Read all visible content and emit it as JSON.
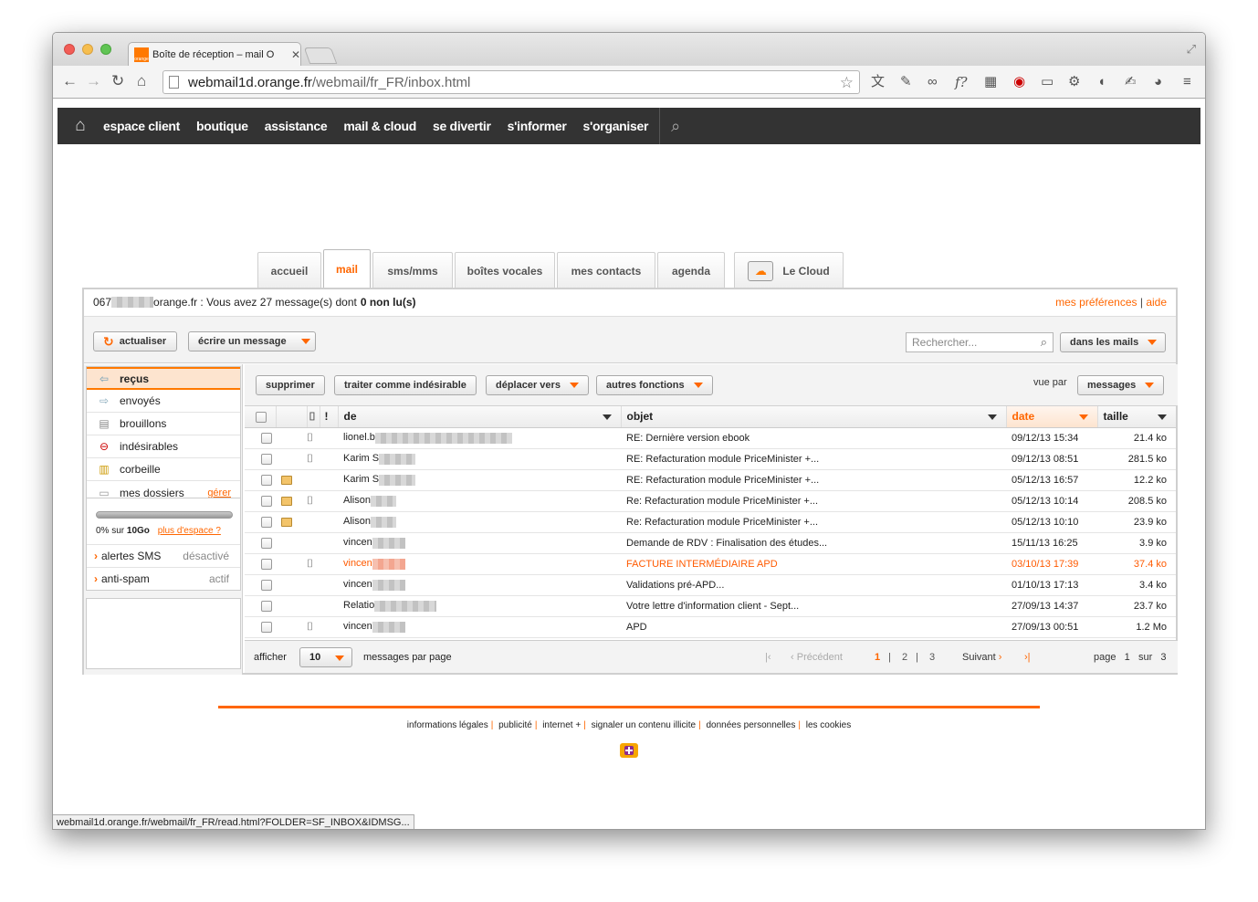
{
  "browser": {
    "tab_title": "Boîte de réception – mail O",
    "url_host": "webmail1d.orange.fr",
    "url_path": "/webmail/fr_FR/inbox.html",
    "status_url": "webmail1d.orange.fr/webmail/fr_FR/read.html?FOLDER=SF_INBOX&IDMSG..."
  },
  "topnav": {
    "items": [
      "espace client",
      "boutique",
      "assistance",
      "mail & cloud",
      "se divertir",
      "s'informer",
      "s'organiser"
    ]
  },
  "service_tabs": {
    "items": [
      "accueil",
      "mail",
      "sms/mms",
      "boîtes vocales",
      "mes contacts",
      "agenda"
    ],
    "active": "mail",
    "cloud": "Le Cloud"
  },
  "account": {
    "prefix": "067",
    "suffix": "orange.fr : Vous avez 27 message(s) dont",
    "unread": "0 non lu(s)",
    "prefs": "mes préférences",
    "help": "aide"
  },
  "actions": {
    "refresh": "actualiser",
    "compose": "écrire un message",
    "search_placeholder": "Rechercher...",
    "search_scope": "dans les mails"
  },
  "folders": [
    {
      "label": "reçus",
      "icon": "inbox-icon"
    },
    {
      "label": "envoyés",
      "icon": "sent-icon"
    },
    {
      "label": "brouillons",
      "icon": "draft-icon"
    },
    {
      "label": "indésirables",
      "icon": "spam-icon"
    },
    {
      "label": "corbeille",
      "icon": "trash-icon"
    },
    {
      "label": "mes dossiers",
      "icon": "folder-icon"
    }
  ],
  "manage_label": "gérer",
  "quota": {
    "used_fraction": 0.0,
    "text_prefix": "0% sur ",
    "text_bold": "10Go",
    "more": "plus d'espace ?"
  },
  "options": [
    {
      "label": "alertes SMS",
      "state": "désactivé"
    },
    {
      "label": "anti-spam",
      "state": "actif"
    }
  ],
  "mail_actions": {
    "delete": "supprimer",
    "spam": "traiter comme indésirable",
    "move": "déplacer vers",
    "more": "autres fonctions",
    "view_by_label": "vue par",
    "view_by": "messages"
  },
  "columns": {
    "from": "de",
    "subject": "objet",
    "date": "date",
    "size": "taille"
  },
  "emails": [
    {
      "from": "lionel.b",
      "attach": true,
      "replied": false,
      "subject": "RE: Dernière version ebook",
      "date": "09/12/13 15:34",
      "size": "21.4 ko",
      "highlight": false
    },
    {
      "from": "Karim S",
      "attach": true,
      "replied": false,
      "subject": "RE: Refacturation module PriceMinister +...",
      "date": "09/12/13 08:51",
      "size": "281.5 ko",
      "highlight": false
    },
    {
      "from": "Karim S",
      "attach": false,
      "replied": true,
      "subject": "RE: Refacturation module PriceMinister +...",
      "date": "05/12/13 16:57",
      "size": "12.2 ko",
      "highlight": false
    },
    {
      "from": "Alison",
      "attach": true,
      "replied": true,
      "subject": "Re: Refacturation module PriceMinister +...",
      "date": "05/12/13 10:14",
      "size": "208.5 ko",
      "highlight": false
    },
    {
      "from": "Alison",
      "attach": false,
      "replied": true,
      "subject": "Re: Refacturation module PriceMinister +...",
      "date": "05/12/13 10:10",
      "size": "23.9 ko",
      "highlight": false
    },
    {
      "from": "vincen",
      "attach": false,
      "replied": false,
      "subject": "Demande de RDV : Finalisation des études...",
      "date": "15/11/13 16:25",
      "size": "3.9 ko",
      "highlight": false
    },
    {
      "from": "vincen",
      "attach": true,
      "replied": false,
      "subject": "FACTURE INTERMÉDIAIRE APD",
      "date": "03/10/13 17:39",
      "size": "37.4 ko",
      "highlight": true
    },
    {
      "from": "vincen",
      "attach": false,
      "replied": false,
      "subject": "Validations pré-APD...",
      "date": "01/10/13 17:13",
      "size": "3.4 ko",
      "highlight": false
    },
    {
      "from": "Relatio",
      "attach": false,
      "replied": false,
      "subject": "Votre lettre d'information client - Sept...",
      "date": "27/09/13 14:37",
      "size": "23.7 ko",
      "highlight": false
    },
    {
      "from": "vincen",
      "attach": true,
      "replied": false,
      "subject": "APD",
      "date": "27/09/13 00:51",
      "size": "1.2 Mo",
      "highlight": false
    }
  ],
  "pager": {
    "show_label": "afficher",
    "per_page": "10",
    "per_page_label": "messages par page",
    "prev": "Précédent",
    "next": "Suivant",
    "pages": [
      "1",
      "2",
      "3"
    ],
    "current": "1",
    "page_label": "page",
    "of_label": "sur",
    "total": "3"
  },
  "footer": {
    "links": [
      "informations légales",
      "publicité",
      "internet +",
      "signaler un contenu illicite",
      "données personnelles",
      "les cookies"
    ]
  },
  "colors": {
    "accent": "#ff6600",
    "nav_bg": "#333333"
  }
}
